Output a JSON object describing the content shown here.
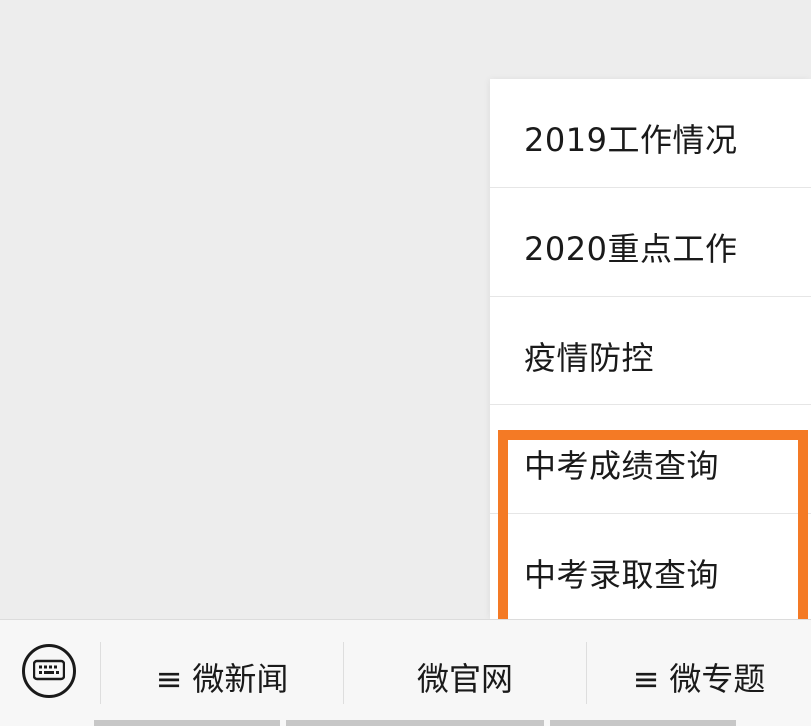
{
  "submenu": {
    "items": [
      {
        "label": "2019工作情况"
      },
      {
        "label": "2020重点工作"
      },
      {
        "label": "疫情防控"
      },
      {
        "label": "中考成绩查询"
      },
      {
        "label": "中考录取查询"
      }
    ]
  },
  "highlight": {
    "color": "#f47a25"
  },
  "menubar": {
    "keyboard_icon": "keyboard-icon",
    "tabs": [
      {
        "label": "微新闻",
        "has_submenu": true,
        "marker": "≡"
      },
      {
        "label": "微官网",
        "has_submenu": false
      },
      {
        "label": "微专题",
        "has_submenu": true,
        "marker": "≡"
      }
    ]
  }
}
